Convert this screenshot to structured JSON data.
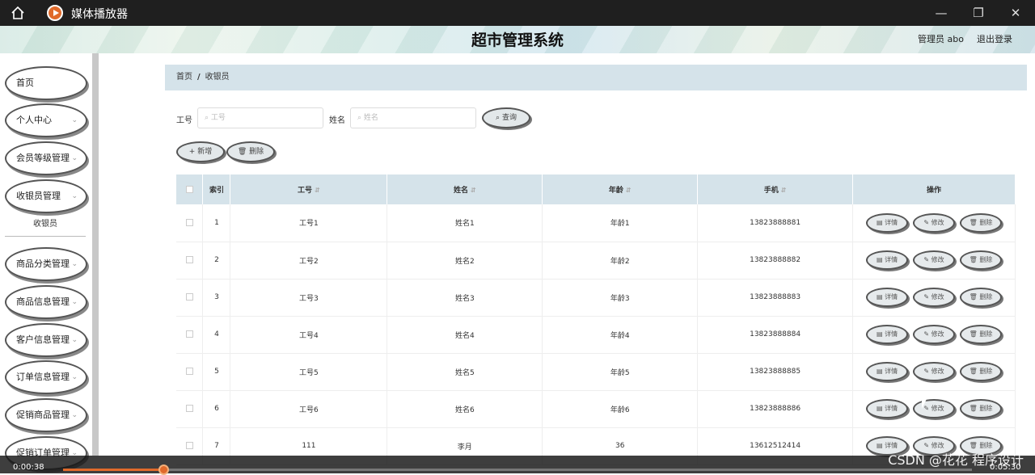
{
  "window": {
    "title": "媒体播放器"
  },
  "header": {
    "system_title": "超市管理系统",
    "user": "管理员 abo",
    "logout": "退出登录"
  },
  "sidebar": {
    "items": [
      {
        "label": "首页"
      },
      {
        "label": "个人中心"
      },
      {
        "label": "会员等级管理"
      },
      {
        "label": "收银员管理"
      },
      {
        "label": "商品分类管理"
      },
      {
        "label": "商品信息管理"
      },
      {
        "label": "客户信息管理"
      },
      {
        "label": "订单信息管理"
      },
      {
        "label": "促销商品管理"
      },
      {
        "label": "促销订单管理"
      }
    ],
    "submenu": "收银员"
  },
  "breadcrumb": {
    "home": "首页",
    "sep": "/",
    "current": "收银员"
  },
  "search": {
    "id_label": "工号",
    "id_placeholder": "工号",
    "name_label": "姓名",
    "name_placeholder": "姓名",
    "query_button": "查询"
  },
  "toolbar": {
    "add": "新增",
    "delete": "删除"
  },
  "table": {
    "headers": {
      "index": "索引",
      "id": "工号",
      "name": "姓名",
      "age": "年龄",
      "phone": "手机",
      "ops": "操作"
    },
    "actions": {
      "detail": "详情",
      "edit": "修改",
      "delete": "删除"
    },
    "rows": [
      {
        "index": "1",
        "id": "工号1",
        "name": "姓名1",
        "age": "年龄1",
        "phone": "13823888881"
      },
      {
        "index": "2",
        "id": "工号2",
        "name": "姓名2",
        "age": "年龄2",
        "phone": "13823888882"
      },
      {
        "index": "3",
        "id": "工号3",
        "name": "姓名3",
        "age": "年龄3",
        "phone": "13823888883"
      },
      {
        "index": "4",
        "id": "工号4",
        "name": "姓名4",
        "age": "年龄4",
        "phone": "13823888884"
      },
      {
        "index": "5",
        "id": "工号5",
        "name": "姓名5",
        "age": "年龄5",
        "phone": "13823888885"
      },
      {
        "index": "6",
        "id": "工号6",
        "name": "姓名6",
        "age": "年龄6",
        "phone": "13823888886"
      },
      {
        "index": "7",
        "id": "111",
        "name": "李月",
        "age": "36",
        "phone": "13612512414"
      }
    ]
  },
  "player": {
    "elapsed": "0:00:38",
    "total": "0:05:30",
    "progress_fraction": 0.11
  },
  "watermark": "CSDN @花花 程序设计"
}
